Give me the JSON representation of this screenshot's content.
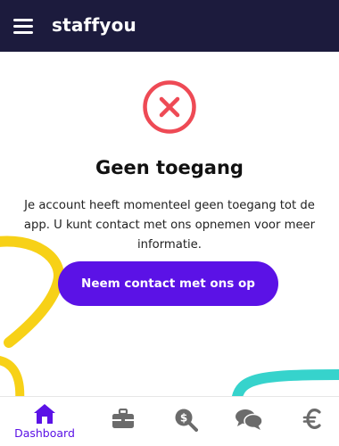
{
  "header": {
    "app_name": "staffyou",
    "menu_icon": "hamburger-menu-icon"
  },
  "main": {
    "status_icon": "close-circle-icon",
    "title": "Geen toegang",
    "message": "Je account heeft momenteel geen toegang tot de app. U kunt contact met ons opnemen voor meer informatie.",
    "cta_label": "Neem contact met ons op"
  },
  "bottom_nav": {
    "items": [
      {
        "label": "Dashboard",
        "icon": "home-icon",
        "active": true
      },
      {
        "label": "",
        "icon": "briefcase-icon",
        "active": false
      },
      {
        "label": "",
        "icon": "money-search-icon",
        "active": false
      },
      {
        "label": "",
        "icon": "chat-icon",
        "active": false
      },
      {
        "label": "",
        "icon": "euro-icon",
        "active": false
      }
    ]
  },
  "colors": {
    "header_bg": "#1c1b3d",
    "accent": "#5b12e6",
    "error": "#ee4a55",
    "decor_yellow": "#f7d117",
    "decor_teal": "#36d3cc",
    "nav_icon_inactive": "#6b6b6b"
  }
}
